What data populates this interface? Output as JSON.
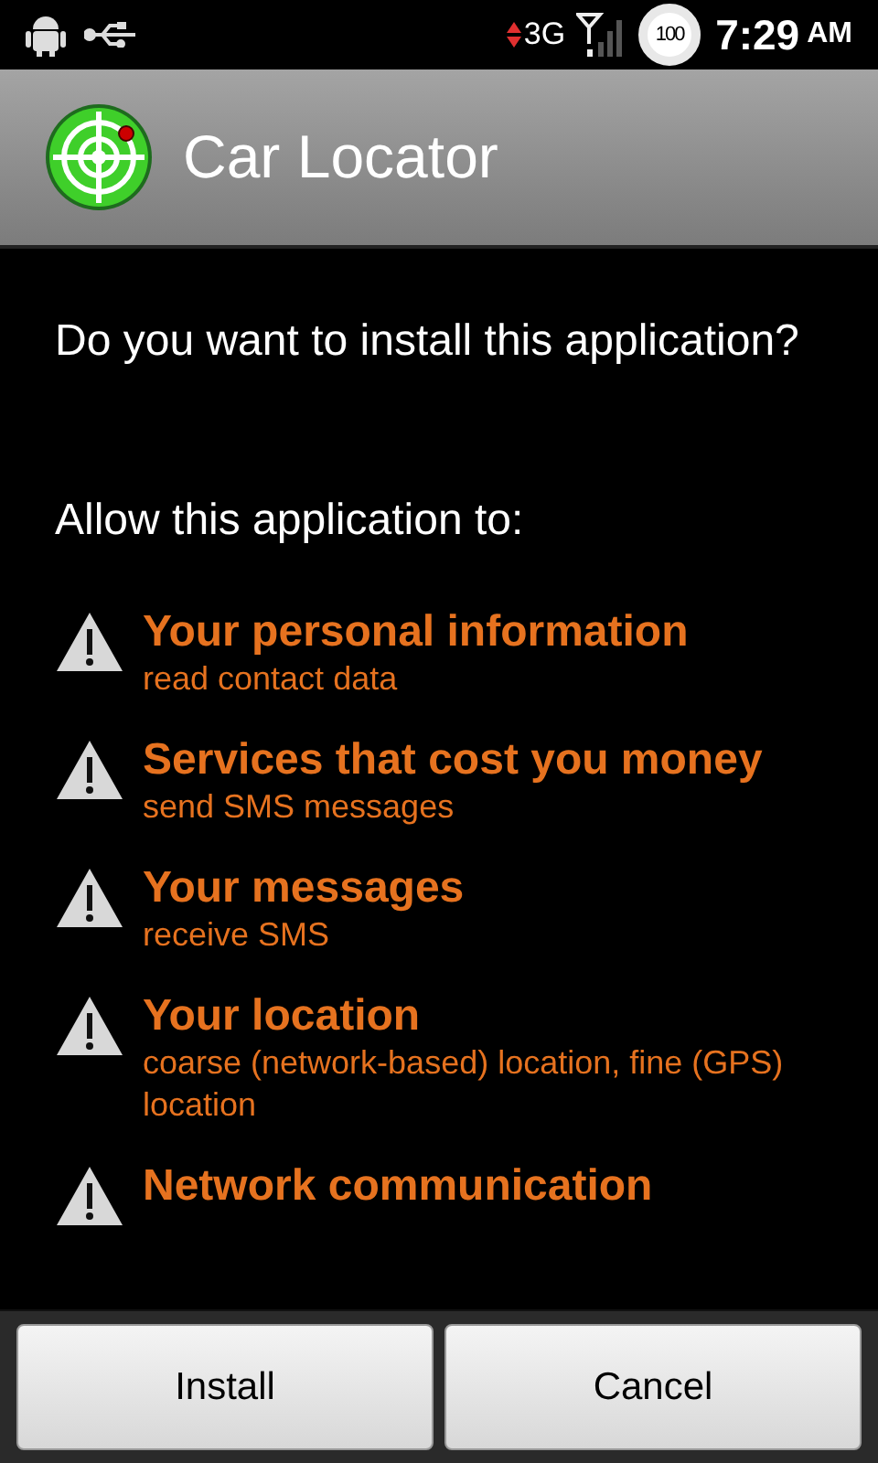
{
  "status_bar": {
    "network": "3G",
    "battery": "100",
    "time": "7:29",
    "meridiem": "AM"
  },
  "title_bar": {
    "title": "Car Locator"
  },
  "question": "Do you want to install this application?",
  "permissions_heading": "Allow this application to:",
  "permissions": [
    {
      "title": "Your personal information",
      "detail": "read contact data"
    },
    {
      "title": "Services that cost you money",
      "detail": "send SMS messages"
    },
    {
      "title": "Your messages",
      "detail": "receive SMS"
    },
    {
      "title": "Your location",
      "detail": "coarse (network-based) location, fine (GPS) location"
    },
    {
      "title": "Network communication"
    }
  ],
  "buttons": [
    {
      "label": "Install"
    },
    {
      "label": "Cancel"
    }
  ]
}
